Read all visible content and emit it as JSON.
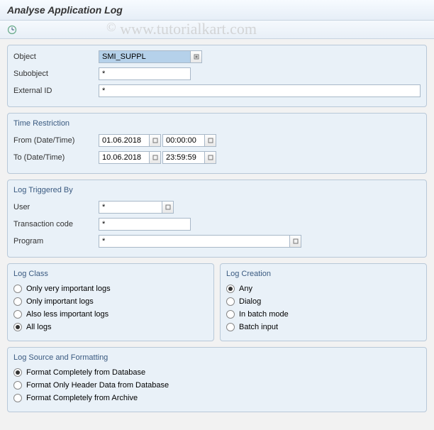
{
  "title": "Analyse Application Log",
  "watermark": "www.tutorialkart.com",
  "section_object": {
    "object_label": "Object",
    "object_value": "SMI_SUPPL",
    "subobject_label": "Subobject",
    "subobject_value": "*",
    "external_id_label": "External ID",
    "external_id_value": "*"
  },
  "section_time": {
    "title": "Time Restriction",
    "from_label": "From (Date/Time)",
    "from_date": "01.06.2018",
    "from_time": "00:00:00",
    "to_label": "To (Date/Time)",
    "to_date": "10.06.2018",
    "to_time": "23:59:59"
  },
  "section_trigger": {
    "title": "Log Triggered By",
    "user_label": "User",
    "user_value": "*",
    "tcode_label": "Transaction code",
    "tcode_value": "*",
    "program_label": "Program",
    "program_value": "*"
  },
  "section_logclass": {
    "title": "Log Class",
    "opt1": "Only very important logs",
    "opt2": "Only important logs",
    "opt3": "Also less important logs",
    "opt4": "All logs"
  },
  "section_logcreation": {
    "title": "Log Creation",
    "opt1": "Any",
    "opt2": "Dialog",
    "opt3": "In batch mode",
    "opt4": "Batch input"
  },
  "section_source": {
    "title": "Log Source and Formatting",
    "opt1": "Format Completely from Database",
    "opt2": "Format Only Header Data from Database",
    "opt3": "Format Completely from Archive"
  }
}
